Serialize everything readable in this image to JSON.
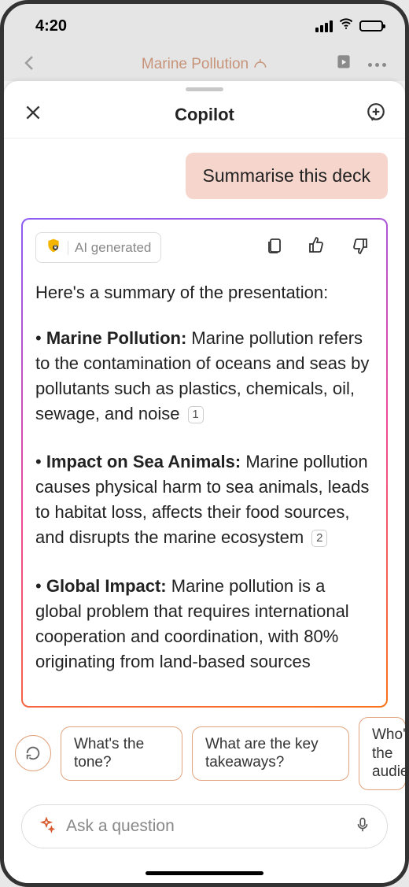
{
  "status": {
    "time": "4:20"
  },
  "app_header": {
    "title": "Marine Pollution"
  },
  "sheet": {
    "title": "Copilot"
  },
  "chat": {
    "user_message": "Summarise this deck",
    "ai_badge_label": "AI generated",
    "summary_intro": "Here's a summary of the presentation:",
    "bullets": [
      {
        "title": "Marine Pollution:",
        "body": " Marine pollution refers to the contamination of oceans and seas by pollutants such as plastics, chemicals, oil, sewage, and noise ",
        "ref": "1"
      },
      {
        "title": "Impact on Sea Animals:",
        "body": " Marine pollution causes physical harm to sea animals, leads to habitat loss, affects their food sources, and disrupts the marine ecosystem ",
        "ref": "2"
      },
      {
        "title": "Global Impact:",
        "body": " Marine pollution is a global problem that requires international cooperation and coordination, with 80% originating from land-based sources ",
        "ref": ""
      }
    ]
  },
  "suggestions": [
    "What's the tone?",
    "What are the key takeaways?",
    "Who's the audience?"
  ],
  "input": {
    "placeholder": "Ask a question"
  }
}
